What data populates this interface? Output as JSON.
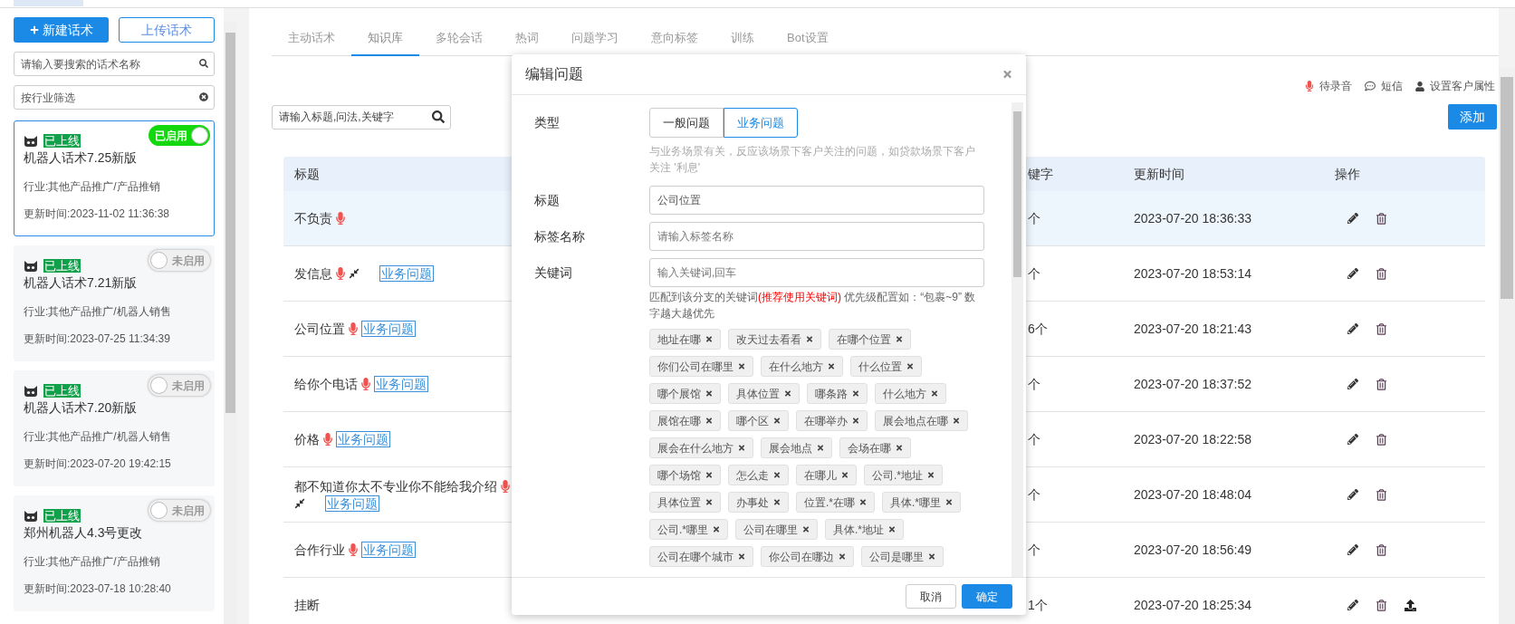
{
  "top_tabs": [
    {
      "selected": true
    }
  ],
  "sidebar": {
    "new_button": "新建话术",
    "upload_button": "上传话术",
    "search": {
      "placeholder": "请输入要搜索的话术名称"
    },
    "industry_filter": {
      "placeholder": "按行业筛选"
    },
    "scripts": [
      {
        "status": "已上线",
        "name": "机器人话术7.25新版",
        "enabled": true,
        "toggle_label": "已启用",
        "industry": "行业:其他产品推广/产品推销",
        "updated": "更新时间:2023-11-02 11:36:38",
        "selected": true
      },
      {
        "status": "已上线",
        "name": "机器人话术7.21新版",
        "enabled": false,
        "toggle_label": "未启用",
        "industry": "行业:其他产品推广/机器人销售",
        "updated": "更新时间:2023-07-25 11:34:39",
        "selected": false
      },
      {
        "status": "已上线",
        "name": "机器人话术7.20新版",
        "enabled": false,
        "toggle_label": "未启用",
        "industry": "行业:其他产品推广/机器人销售",
        "updated": "更新时间:2023-07-20 19:42:15",
        "selected": false
      },
      {
        "status": "已上线",
        "name": "郑州机器人4.3号更改",
        "enabled": false,
        "toggle_label": "未启用",
        "industry": "行业:其他产品推广/产品推销",
        "updated": "更新时间:2023-07-18 10:28:40",
        "selected": false
      }
    ]
  },
  "tabs": [
    {
      "label": "主动话术",
      "selected": false
    },
    {
      "label": "知识库",
      "selected": true
    },
    {
      "label": "多轮会话",
      "selected": false
    },
    {
      "label": "热词",
      "selected": false
    },
    {
      "label": "问题学习",
      "selected": false
    },
    {
      "label": "意向标签",
      "selected": false
    },
    {
      "label": "训练",
      "selected": false
    },
    {
      "label": "Bot设置",
      "selected": false
    }
  ],
  "toolbar_links": [
    {
      "kind": "mic",
      "label": "待录音"
    },
    {
      "kind": "sms",
      "label": "短信"
    },
    {
      "kind": "user",
      "label": "设置客户属性"
    }
  ],
  "search": {
    "placeholder": "请输入标题,问法,关键字"
  },
  "add_button": "添加",
  "table": {
    "columns": [
      "标题",
      "键字",
      "更新时间",
      "操作"
    ],
    "rows": [
      {
        "title": "不负责",
        "mic": true,
        "shrink": false,
        "keywords": "个",
        "updated": "2023-07-20 18:36:33",
        "upload": false,
        "selected": true
      },
      {
        "title": "发信息",
        "mic": true,
        "shrink": true,
        "tag": "业务问题",
        "keywords": "个",
        "updated": "2023-07-20 18:53:14",
        "upload": false,
        "selected": false
      },
      {
        "title": "公司位置",
        "mic": true,
        "shrink": false,
        "tag": "业务问题",
        "keywords": "6个",
        "updated": "2023-07-20 18:21:43",
        "upload": false,
        "selected": false
      },
      {
        "title": "给你个电话",
        "mic": true,
        "shrink": false,
        "tag": "业务问题",
        "keywords": "个",
        "updated": "2023-07-20 18:37:52",
        "upload": false,
        "selected": false
      },
      {
        "title": "价格",
        "mic": true,
        "shrink": false,
        "tag": "业务问题",
        "keywords": "个",
        "updated": "2023-07-20 18:22:58",
        "upload": false,
        "selected": false
      },
      {
        "title": "都不知道你太不专业你不能给我介绍",
        "mic": true,
        "shrink": true,
        "tag": "业务问题",
        "keywords": "个",
        "updated": "2023-07-20 18:48:04",
        "upload": false,
        "selected": false
      },
      {
        "title": "合作行业",
        "mic": true,
        "shrink": false,
        "tag": "业务问题",
        "keywords": "个",
        "updated": "2023-07-20 18:56:49",
        "upload": false,
        "selected": false
      },
      {
        "title": "挂断",
        "mic": false,
        "shrink": false,
        "keywords": "1个",
        "updated": "2023-07-20 18:25:34",
        "upload": true,
        "selected": false
      }
    ]
  },
  "dialog": {
    "title": "编辑问题",
    "type_label": "类型",
    "type_options": [
      {
        "label": "一般问题",
        "selected": false
      },
      {
        "label": "业务问题",
        "selected": true
      }
    ],
    "type_hint": "与业务场景有关，反应该场景下客户关注的问题，如贷款场景下客户关注 '利息'",
    "title_label": "标题",
    "title_value": "公司位置",
    "tag_label": "标签名称",
    "tag_placeholder": "请输入标签名称",
    "keyword_label": "关键词",
    "keyword_placeholder": "输入关键词,回车",
    "keyword_hint": [
      {
        "kind": "normal",
        "text": "匹配到该分支的关键词"
      },
      {
        "kind": "warning",
        "text": "(推荐使用关键词)"
      },
      {
        "kind": "normal",
        "text": " 优先级配置如：“包裹~9” 数字越大越优先"
      }
    ],
    "keyword_rows": [
      [
        "地址在哪",
        "改天过去看看",
        "在哪个位置"
      ],
      [
        "你们公司在哪里",
        "在什么地方",
        "什么位置"
      ],
      [
        "哪个展馆",
        "具体位置",
        "哪条路",
        "什么地方"
      ],
      [
        "展馆在哪",
        "哪个区",
        "在哪举办",
        "展会地点在哪"
      ],
      [
        "展会在什么地方",
        "展会地点",
        "会场在哪"
      ],
      [
        "哪个场馆",
        "怎么走",
        "在哪儿",
        "公司.*地址"
      ],
      [
        "具体位置",
        "办事处",
        "位置.*在哪",
        "具体.*哪里"
      ],
      [
        "公司.*哪里",
        "公司在哪里",
        "具体.*地址"
      ],
      [
        "公司在哪个城市",
        "你公司在哪边",
        "公司是哪里"
      ]
    ],
    "cancel_button": "取消",
    "ok_button": "确定"
  }
}
